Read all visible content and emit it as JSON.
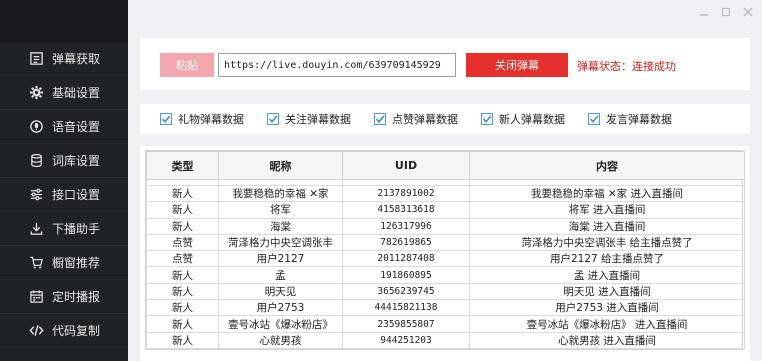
{
  "sidebar": {
    "items": [
      {
        "label": "弹幕获取",
        "icon": "danmaku-icon"
      },
      {
        "label": "基础设置",
        "icon": "gear-icon"
      },
      {
        "label": "语音设置",
        "icon": "voice-icon"
      },
      {
        "label": "词库设置",
        "icon": "database-icon"
      },
      {
        "label": "接口设置",
        "icon": "sliders-icon"
      },
      {
        "label": "下播助手",
        "icon": "download-icon"
      },
      {
        "label": "橱窗推荐",
        "icon": "cart-icon"
      },
      {
        "label": "定时播报",
        "icon": "calendar-icon"
      },
      {
        "label": "代码复制",
        "icon": "code-icon"
      }
    ]
  },
  "toolbar": {
    "paste_label": "粘贴",
    "url_value": "https://live.douyin.com/639709145929",
    "close_label": "关闭弹幕",
    "status_text": "弹幕状态：连接成功"
  },
  "filters": [
    {
      "label": "礼物弹幕数据",
      "checked": true
    },
    {
      "label": "关注弹幕数据",
      "checked": true
    },
    {
      "label": "点赞弹幕数据",
      "checked": true
    },
    {
      "label": "新人弹幕数据",
      "checked": true
    },
    {
      "label": "发言弹幕数据",
      "checked": true
    }
  ],
  "table": {
    "headers": [
      "类型",
      "昵称",
      "UID",
      "内容"
    ],
    "rows": [
      [
        "新人",
        "我要稳稳的幸福 ✕家",
        "2137891002",
        "我要稳稳的幸福 ✕家 进入直播间"
      ],
      [
        "新人",
        "将军",
        "4158313618",
        "将军 进入直播间"
      ],
      [
        "新人",
        "海棠",
        "126317996",
        "海棠 进入直播间"
      ],
      [
        "点赞",
        "菏泽格力中央空调张丰",
        "782619865",
        "菏泽格力中央空调张丰 给主播点赞了"
      ],
      [
        "点赞",
        "用户2127",
        "2011287408",
        "用户2127 给主播点赞了"
      ],
      [
        "新人",
        "孟",
        "191860895",
        "孟 进入直播间"
      ],
      [
        "新人",
        "明天见",
        "3656239745",
        "明天见 进入直播间"
      ],
      [
        "新人",
        "用户2753",
        "44415821138",
        "用户2753 进入直播间"
      ],
      [
        "新人",
        "壹号冰站《爆冰粉店》",
        "2359855807",
        "壹号冰站《爆冰粉店》 进入直播间"
      ],
      [
        "新人",
        "心就男孩",
        "944251203",
        "心就男孩 进入直播间"
      ]
    ]
  },
  "colors": {
    "sidebar_bg": "#1f2227",
    "accent_red": "#e5302d",
    "paste_pink": "#f3a6ad",
    "checkbox_blue": "#4a9bd6"
  }
}
